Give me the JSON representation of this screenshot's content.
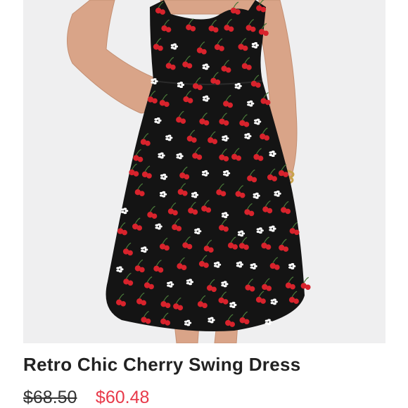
{
  "listing": {
    "title": "Retro Chic Cherry Swing Dress",
    "original_price": "$68.50",
    "sale_price": "$60.48",
    "sale_price_color": "#e83a4a"
  },
  "photo": {
    "next_icon": "chevron-right-icon",
    "dress_color": "#141414",
    "cherry_color": "#d8232c",
    "flower_color": "#ffffff",
    "background_color": "#efeff0"
  }
}
